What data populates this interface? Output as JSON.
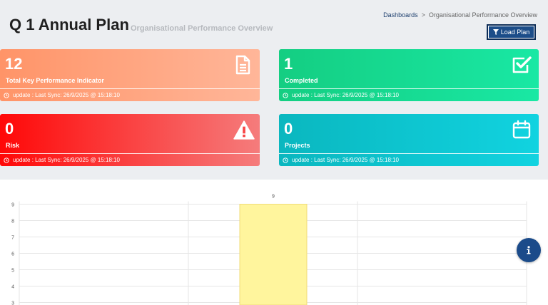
{
  "header": {
    "title": "Q 1 Annual Plan",
    "subtitle": "Organisational Performance Overview"
  },
  "breadcrumb": {
    "home": "Dashboards",
    "separator": ">",
    "current": "Organisational Performance Overview"
  },
  "toolbar": {
    "load_label": "Load Plan",
    "load_icon": "filter-icon"
  },
  "cards": {
    "kpi": {
      "value": "12",
      "label": "Total Key Performance Indicator",
      "footer": "update : Last Sync: 26/9/2025 @ 15:18:10",
      "icon": "document-icon",
      "color": "#ff9468"
    },
    "completed": {
      "value": "1",
      "label": "Completed",
      "footer": "update : Last Sync: 26/9/2025 @ 15:18:10",
      "icon": "checkbox-icon",
      "color": "#14ce82"
    },
    "risk": {
      "value": "0",
      "label": "Risk",
      "footer": "update : Last Sync: 26/9/2025 @ 15:18:10",
      "icon": "warning-icon",
      "color": "#ff0808"
    },
    "projects": {
      "value": "0",
      "label": "Projects",
      "footer": "update : Last Sync: 26/9/2025 @ 15:18:10",
      "icon": "calendar-icon",
      "color": "#0ab7bf"
    }
  },
  "chart_data": {
    "type": "bar",
    "categories": [
      "",
      "",
      ""
    ],
    "values": [
      0,
      9,
      0
    ],
    "data_labels": [
      "",
      "9",
      ""
    ],
    "visible_ticks": [
      3,
      4,
      5,
      6,
      7,
      8,
      9
    ],
    "ylim": [
      0,
      9.5
    ],
    "bar_color": "#fff59d",
    "bar_border": "#f0dc7a",
    "grid": true
  },
  "info_button": {
    "icon": "info-icon"
  }
}
